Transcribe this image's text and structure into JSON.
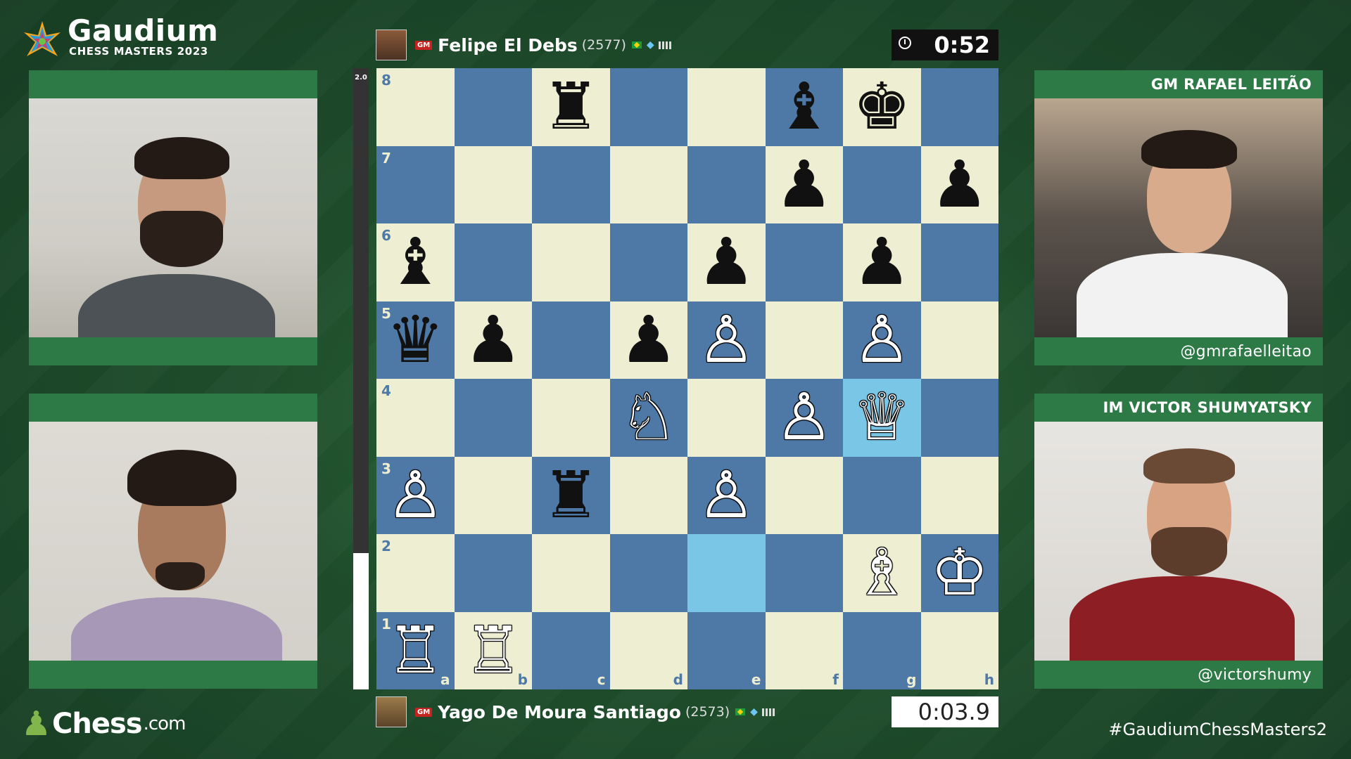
{
  "brand": {
    "name": "Gaudium",
    "subtitle": "CHESS MASTERS 2023"
  },
  "players": {
    "top": {
      "title": "GM",
      "name": "Felipe El Debs",
      "rating": "(2577)",
      "clock": "0:52"
    },
    "bottom": {
      "title": "GM",
      "name": "Yago De Moura Santiago",
      "rating": "(2573)",
      "clock": "0:03.9"
    }
  },
  "eval": {
    "label": "2.0",
    "white_fraction": 0.22
  },
  "commentators": [
    {
      "title": "GM RAFAEL LEITÃO",
      "handle": "@gmrafaelleitao"
    },
    {
      "title": "IM VICTOR SHUMYATSKY",
      "handle": "@victorshumy"
    }
  ],
  "board": {
    "ranks": [
      "8",
      "7",
      "6",
      "5",
      "4",
      "3",
      "2",
      "1"
    ],
    "files": [
      "a",
      "b",
      "c",
      "d",
      "e",
      "f",
      "g",
      "h"
    ],
    "position": [
      [
        "",
        "",
        "♜",
        "",
        "",
        "♝",
        "♚",
        ""
      ],
      [
        "",
        "",
        "",
        "",
        "",
        "♟",
        "",
        "♟"
      ],
      [
        "♝",
        "",
        "",
        "",
        "♟",
        "",
        "♟",
        ""
      ],
      [
        "♛",
        "♟",
        "",
        "♟",
        "♙",
        "",
        "♙",
        ""
      ],
      [
        "",
        "",
        "",
        "♘",
        "",
        "♙",
        "♕",
        ""
      ],
      [
        "♙",
        "",
        "♜",
        "",
        "♙",
        "",
        "",
        ""
      ],
      [
        "",
        "",
        "",
        "",
        "",
        "",
        "♗",
        "♔"
      ],
      [
        "♖",
        "♖",
        "",
        "",
        "",
        "",
        "",
        ""
      ]
    ],
    "highlights": [
      "g4",
      "e2"
    ]
  },
  "footer": {
    "sponsor": "Chess",
    "sponsor_suffix": ".com",
    "hashtag": "#GaudiumChessMasters2"
  },
  "colors": {
    "light_square": "#eeeed2",
    "dark_square": "#4e79a7",
    "highlight": "#79c6e6",
    "panel_green": "#2d7a46"
  }
}
